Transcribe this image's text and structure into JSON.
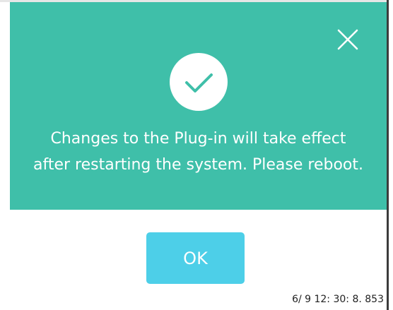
{
  "dialog": {
    "message_line1": "Changes to the Plug-in will take effect",
    "message_line2": "after restarting the system. Please reboot.",
    "status_icon": "checkmark-icon",
    "close_icon": "close-icon",
    "ok_label": "OK"
  },
  "footer": {
    "timestamp": "6/ 9 12: 30: 8. 853"
  },
  "colors": {
    "header_bg": "#3fbfa9",
    "ok_button_bg": "#4dcfe8",
    "text_on_header": "#ffffff"
  }
}
